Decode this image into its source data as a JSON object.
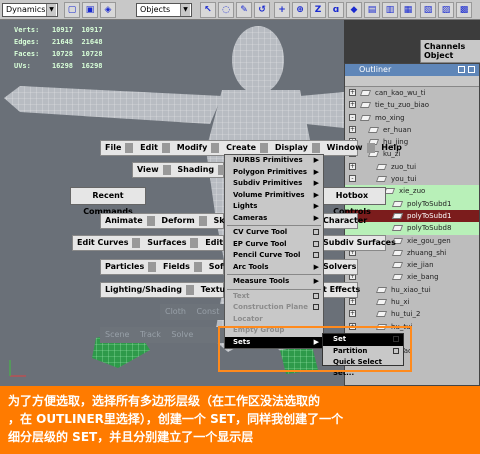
{
  "toolbar": {
    "mode_select": "Dynamics",
    "objects_select": "Objects",
    "tool_icons": [
      "select-icon",
      "lasso-icon",
      "paint-icon",
      "move-icon",
      "rotate-icon",
      "scale-icon",
      "history-icon",
      "snap-icon",
      "render-icon",
      "ipr-icon",
      "render-settings-icon",
      "display-icon",
      "channels-icon"
    ]
  },
  "hud": {
    "rows": [
      {
        "label": "Verts:",
        "a": "10917",
        "b": "10917"
      },
      {
        "label": "Edges:",
        "a": "21648",
        "b": "21648"
      },
      {
        "label": "Faces:",
        "a": "10728",
        "b": "10728"
      },
      {
        "label": "UVs:",
        "a": "16298",
        "b": "16298"
      }
    ]
  },
  "channels": {
    "header": "Channels  Object",
    "object": "polyToSubd5"
  },
  "outliner": {
    "title": "Outliner",
    "rows": [
      {
        "label": "can_kao_wu_ti",
        "indent": 0,
        "expand": "+",
        "style": ""
      },
      {
        "label": "tie_tu_zuo_biao",
        "indent": 0,
        "expand": "+",
        "style": ""
      },
      {
        "label": "mo_xing",
        "indent": 0,
        "expand": "-",
        "style": ""
      },
      {
        "label": "er_huan",
        "indent": 1,
        "expand": "+",
        "style": ""
      },
      {
        "label": "hu_jing",
        "indent": 1,
        "expand": "+",
        "style": ""
      },
      {
        "label": "ku_zi",
        "indent": 1,
        "expand": "-",
        "style": ""
      },
      {
        "label": "zuo_tui",
        "indent": 2,
        "expand": "+",
        "style": ""
      },
      {
        "label": "you_tui",
        "indent": 2,
        "expand": "-",
        "style": ""
      },
      {
        "label": "xie_zuo",
        "indent": 3,
        "expand": "-",
        "style": "green"
      },
      {
        "label": "polyToSubd1",
        "indent": 4,
        "expand": "",
        "style": "green"
      },
      {
        "label": "polyToSubd1",
        "indent": 4,
        "expand": "",
        "style": "selected"
      },
      {
        "label": "polyToSubd8",
        "indent": 4,
        "expand": "",
        "style": "green"
      },
      {
        "label": "xie_gou_gen",
        "indent": 4,
        "expand": "+",
        "style": ""
      },
      {
        "label": "zhuang_shi",
        "indent": 4,
        "expand": "+",
        "style": ""
      },
      {
        "label": "xie_jian",
        "indent": 4,
        "expand": "+",
        "style": ""
      },
      {
        "label": "xie_bang",
        "indent": 4,
        "expand": "+",
        "style": ""
      },
      {
        "label": "hu_xiao_tui",
        "indent": 2,
        "expand": "+",
        "style": ""
      },
      {
        "label": "hu_xi",
        "indent": 2,
        "expand": "+",
        "style": ""
      },
      {
        "label": "hu_tui_2",
        "indent": 2,
        "expand": "+",
        "style": ""
      },
      {
        "label": "hu_tui",
        "indent": 2,
        "expand": "+",
        "style": ""
      },
      {
        "label": "bu1",
        "indent": 2,
        "expand": "+",
        "style": ""
      },
      {
        "label": "ShouTao",
        "indent": 1,
        "expand": "+",
        "style": ""
      }
    ]
  },
  "hotbox": {
    "top_menu": [
      "File",
      "Edit",
      "Modify",
      "Create",
      "Display",
      "Window",
      "Help"
    ],
    "view_row": [
      "View",
      "Shading",
      "L"
    ],
    "recent_commands": "Recent Commands",
    "hotbox_controls": "Hotbox Controls",
    "animation_row": [
      "Animate",
      "Deform",
      "Skeleton"
    ],
    "character": "Character",
    "modeling_row": [
      "Edit Curves",
      "Surfaces",
      "Edit NURBS"
    ],
    "subdiv_surfaces": "Subdiv Surfaces",
    "dynamics_row": [
      "Particles",
      "Fields",
      "Soft/F"
    ],
    "solvers": "Solvers",
    "rendering_row": [
      "Lighting/Shading",
      "Texturin"
    ],
    "effects": "t Effects",
    "dim_row1": [
      "Cloth",
      "Const"
    ],
    "dim_row2": [
      "Scene",
      "Track",
      "Solve"
    ]
  },
  "marking_menu": {
    "items": [
      {
        "label": "NURBS Primitives",
        "kind": "sub"
      },
      {
        "label": "Polygon Primitives",
        "kind": "sub"
      },
      {
        "label": "Subdiv Primitives",
        "kind": "sub"
      },
      {
        "label": "Volume Primitives",
        "kind": "sub"
      },
      {
        "label": "Lights",
        "kind": "sub"
      },
      {
        "label": "Cameras",
        "kind": "sub"
      },
      {
        "label": "",
        "kind": "sep"
      },
      {
        "label": "CV Curve Tool",
        "kind": "opt"
      },
      {
        "label": "EP Curve Tool",
        "kind": "opt"
      },
      {
        "label": "Pencil Curve Tool",
        "kind": "opt"
      },
      {
        "label": "Arc Tools",
        "kind": "sub"
      },
      {
        "label": "",
        "kind": "sep"
      },
      {
        "label": "Measure Tools",
        "kind": "sub"
      },
      {
        "label": "",
        "kind": "sep"
      },
      {
        "label": "Text",
        "kind": "dimopt"
      },
      {
        "label": "Construction Plane",
        "kind": "dimopt"
      },
      {
        "label": "Locator",
        "kind": "dim"
      },
      {
        "label": "Empty Group",
        "kind": "dim"
      },
      {
        "label": "Sets",
        "kind": "hlsub"
      }
    ]
  },
  "sets_submenu": {
    "items": [
      {
        "label": "Set",
        "hl": true
      },
      {
        "label": "Partition",
        "hl": false
      },
      {
        "label": "Quick Select Set...",
        "hl": false
      }
    ]
  },
  "caption": {
    "line1": "为了方便选取，选择所有多边形层级（在工作区没法选取的",
    "line2": "，在 OUTLINER里选择），创建一个 SET，同样我创建了一个",
    "line3": "细分层级的 SET，并且分别建立了一个显示层"
  },
  "colors": {
    "caption_bg": "#ff7b00",
    "selection_highlight": "#7b1c1c",
    "outliner_set_highlight": "#b8f0b8",
    "frame_highlight": "#ff8a1c"
  }
}
